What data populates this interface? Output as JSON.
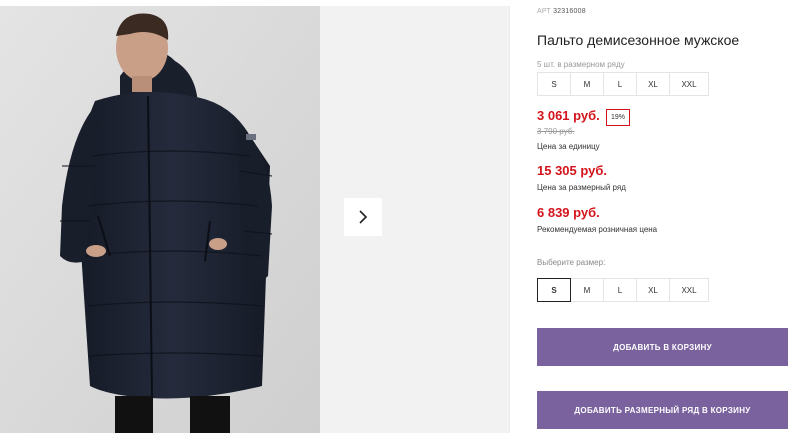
{
  "product": {
    "sku_label": "АРТ",
    "sku_value": "32316008",
    "title": "Пальто демисезонное мужское"
  },
  "size_row": {
    "note": "5 шт. в размерном ряду",
    "sizes": [
      "S",
      "M",
      "L",
      "XL",
      "XXL"
    ]
  },
  "pricing": {
    "unit_price": "3 061 руб.",
    "discount_badge": "19%",
    "old_price": "3 790 руб.",
    "unit_caption": "Цена за единицу",
    "row_price": "15 305 руб.",
    "row_caption": "Цена за размерный ряд",
    "retail_price": "6 839 руб.",
    "retail_caption": "Рекомендуемая розничная цена"
  },
  "size_picker": {
    "label": "Выберите размер:",
    "options": [
      "S",
      "M",
      "L",
      "XL",
      "XXL"
    ],
    "selected": "S"
  },
  "actions": {
    "add_to_cart": "ДОБАВИТЬ В КОРЗИНУ",
    "add_row_to_cart": "ДОБАВИТЬ РАЗМЕРНЫЙ РЯД В КОРЗИНУ"
  },
  "gallery": {
    "next_icon": "chevron-right-icon"
  },
  "colors": {
    "price_red": "#d4141c",
    "button_purple": "#7a629e",
    "jacket": "#1c2130"
  }
}
